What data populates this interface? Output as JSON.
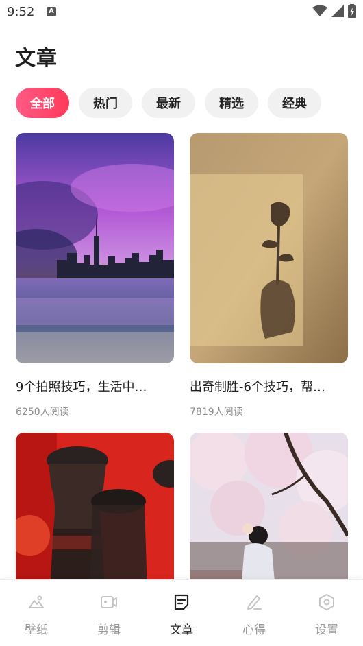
{
  "status_bar": {
    "time": "9:52",
    "notification_icon": "A"
  },
  "page": {
    "title": "文章"
  },
  "tabs": [
    {
      "label": "全部",
      "active": true
    },
    {
      "label": "热门",
      "active": false
    },
    {
      "label": "最新",
      "active": false
    },
    {
      "label": "精选",
      "active": false
    },
    {
      "label": "经典",
      "active": false
    }
  ],
  "articles": [
    {
      "title": "9个拍照技巧，生活中…",
      "reads": "6250人阅读",
      "image": "purple-sky-city-skyline-photo"
    },
    {
      "title": "出奇制胜-6个技巧，帮…",
      "reads": "7819人阅读",
      "image": "rose-shadow-on-wall-photo"
    },
    {
      "title": "",
      "reads": "",
      "image": "coca-cola-bottles-photo"
    },
    {
      "title": "",
      "reads": "",
      "image": "cherry-blossom-girl-photo"
    }
  ],
  "bottom_nav": [
    {
      "label": "壁纸",
      "icon": "mountain-image-icon",
      "active": false
    },
    {
      "label": "剪辑",
      "icon": "video-clip-icon",
      "active": false
    },
    {
      "label": "文章",
      "icon": "document-icon",
      "active": true
    },
    {
      "label": "心得",
      "icon": "pen-icon",
      "active": false
    },
    {
      "label": "设置",
      "icon": "settings-hexagon-icon",
      "active": false
    }
  ],
  "colors": {
    "accent_start": "#ff5a86",
    "accent_end": "#ff3a59",
    "muted": "#9a9a9a"
  }
}
